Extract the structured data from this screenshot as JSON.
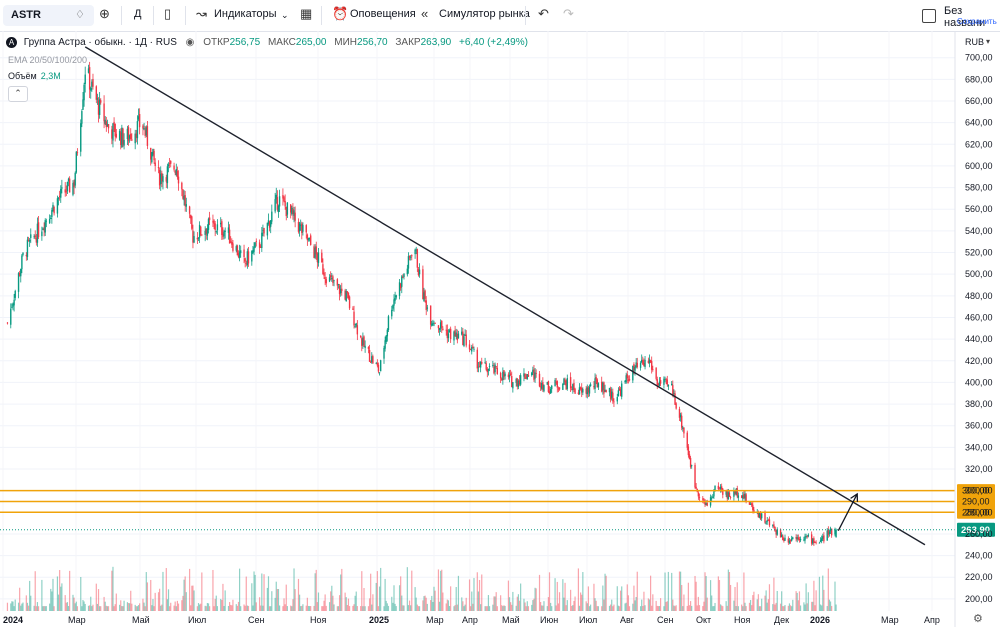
{
  "toolbar": {
    "symbol": "ASTR",
    "interval": "Д",
    "indicators": "Индикаторы",
    "alerts": "Оповещения",
    "replay": "Симулятор рынка",
    "layout_title": "Без названи",
    "layout_saved": "Сохранить"
  },
  "legend": {
    "title": "Группа Астра · обыкн. · 1Д · RUS",
    "open_label": "ОТКР",
    "open": "256,75",
    "high_label": "МАКС",
    "high": "265,00",
    "low_label": "МИН",
    "low": "256,70",
    "close_label": "ЗАКР",
    "close": "263,90",
    "change": "+6,40 (+2,49%)",
    "ema": "EMA 20/50/100/200",
    "volume_label": "Объём",
    "volume": "2,3M"
  },
  "price_scale": {
    "currency": "RUB",
    "ticks": [
      "700,00",
      "680,00",
      "660,00",
      "640,00",
      "620,00",
      "600,00",
      "580,00",
      "560,00",
      "540,00",
      "520,00",
      "500,00",
      "480,00",
      "460,00",
      "440,00",
      "420,00",
      "400,00",
      "380,00",
      "360,00",
      "340,00",
      "320,00",
      "300,00",
      "280,00",
      "260,00",
      "240,00",
      "220,00",
      "200,00"
    ],
    "last_price": "263,90",
    "level_labels": [
      "300,00",
      "290,00",
      "280,00"
    ]
  },
  "colors": {
    "up": "#089981",
    "down": "#f23645",
    "level": "#f0a30a",
    "trendline": "#1e222d"
  },
  "chart_data": {
    "type": "candlestick",
    "title": "Группа Астра · обыкн. · 1Д · RUS",
    "x_ticks": [
      "2024",
      "Мар",
      "Май",
      "Июл",
      "Сен",
      "Ноя",
      "2025",
      "Мар",
      "Апр",
      "Май",
      "Июн",
      "Июл",
      "Авг",
      "Сен",
      "Окт",
      "Ноя",
      "Дек",
      "2026",
      "Мар",
      "Апр"
    ],
    "ylim": [
      190,
      720
    ],
    "price_path": [
      {
        "t": "2024-01-05",
        "p": 455
      },
      {
        "t": "2024-01-20",
        "p": 520
      },
      {
        "t": "2024-02-05",
        "p": 545
      },
      {
        "t": "2024-02-20",
        "p": 570
      },
      {
        "t": "2024-03-05",
        "p": 585
      },
      {
        "t": "2024-03-15",
        "p": 690
      },
      {
        "t": "2024-03-25",
        "p": 660
      },
      {
        "t": "2024-04-05",
        "p": 635
      },
      {
        "t": "2024-04-20",
        "p": 625
      },
      {
        "t": "2024-05-05",
        "p": 640
      },
      {
        "t": "2024-05-20",
        "p": 590
      },
      {
        "t": "2024-06-05",
        "p": 600
      },
      {
        "t": "2024-06-20",
        "p": 535
      },
      {
        "t": "2024-07-05",
        "p": 545
      },
      {
        "t": "2024-07-20",
        "p": 540
      },
      {
        "t": "2024-08-05",
        "p": 510
      },
      {
        "t": "2024-08-20",
        "p": 530
      },
      {
        "t": "2024-09-05",
        "p": 570
      },
      {
        "t": "2024-09-20",
        "p": 550
      },
      {
        "t": "2024-10-05",
        "p": 525
      },
      {
        "t": "2024-10-20",
        "p": 495
      },
      {
        "t": "2024-11-05",
        "p": 480
      },
      {
        "t": "2024-11-20",
        "p": 435
      },
      {
        "t": "2024-12-05",
        "p": 410
      },
      {
        "t": "2024-12-15",
        "p": 470
      },
      {
        "t": "2024-12-31",
        "p": 510
      },
      {
        "t": "2025-01-05",
        "p": 530
      },
      {
        "t": "2025-01-12",
        "p": 485
      },
      {
        "t": "2025-01-20",
        "p": 460
      },
      {
        "t": "2025-02-05",
        "p": 445
      },
      {
        "t": "2025-02-20",
        "p": 440
      },
      {
        "t": "2025-03-05",
        "p": 415
      },
      {
        "t": "2025-03-20",
        "p": 410
      },
      {
        "t": "2025-04-05",
        "p": 400
      },
      {
        "t": "2025-04-20",
        "p": 410
      },
      {
        "t": "2025-05-05",
        "p": 395
      },
      {
        "t": "2025-05-20",
        "p": 400
      },
      {
        "t": "2025-06-05",
        "p": 390
      },
      {
        "t": "2025-06-20",
        "p": 400
      },
      {
        "t": "2025-07-05",
        "p": 385
      },
      {
        "t": "2025-07-20",
        "p": 410
      },
      {
        "t": "2025-08-05",
        "p": 420
      },
      {
        "t": "2025-08-12",
        "p": 400
      },
      {
        "t": "2025-08-25",
        "p": 395
      },
      {
        "t": "2025-09-05",
        "p": 355
      },
      {
        "t": "2025-09-15",
        "p": 305
      },
      {
        "t": "2025-09-25",
        "p": 285
      },
      {
        "t": "2025-10-05",
        "p": 305
      },
      {
        "t": "2025-10-15",
        "p": 295
      },
      {
        "t": "2025-10-25",
        "p": 300
      },
      {
        "t": "2025-11-05",
        "p": 285
      },
      {
        "t": "2025-11-20",
        "p": 270
      },
      {
        "t": "2025-12-05",
        "p": 255
      },
      {
        "t": "2025-12-20",
        "p": 258
      },
      {
        "t": "2026-01-05",
        "p": 252
      },
      {
        "t": "2026-01-12",
        "p": 260
      },
      {
        "t": "2026-01-20",
        "p": 263.9
      }
    ],
    "trendline": [
      {
        "t": "2024-03-15",
        "p": 710
      },
      {
        "t": "2026-04-10",
        "p": 250
      }
    ],
    "horizontal_levels": [
      300,
      290,
      280
    ],
    "last_close": 263.9,
    "forecast_arrow": [
      {
        "t": "2026-01-22",
        "p": 263
      },
      {
        "t": "2026-02-08",
        "p": 297
      }
    ]
  }
}
